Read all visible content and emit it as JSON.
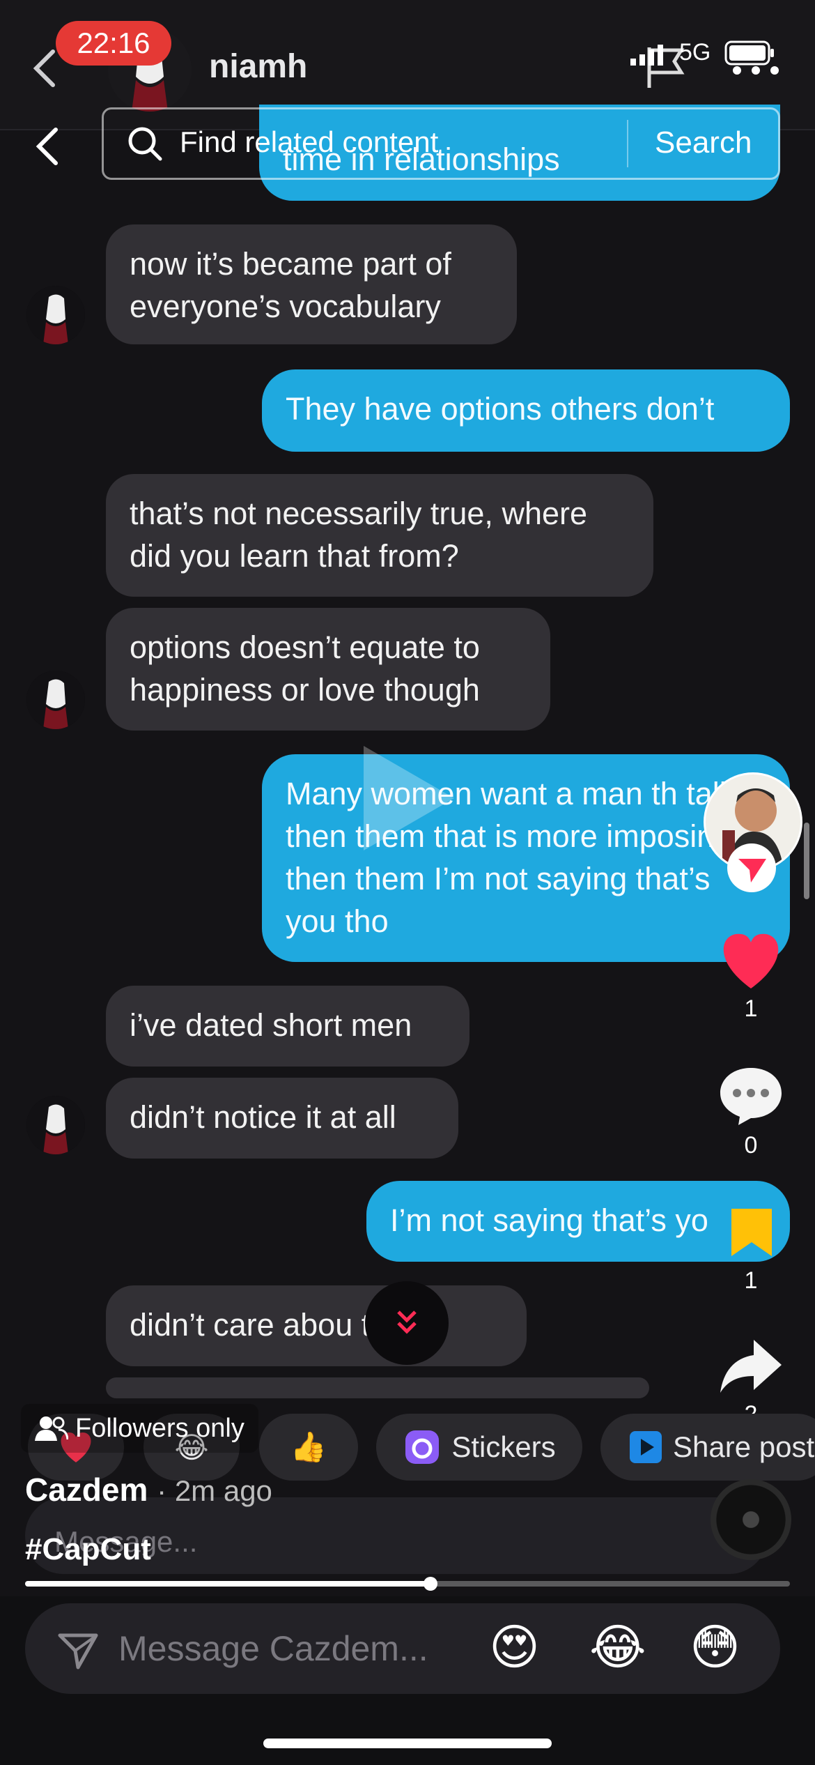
{
  "status": {
    "time": "22:16",
    "network": "5G"
  },
  "chat": {
    "contact_name": "niamh"
  },
  "search": {
    "placeholder": "Find related content",
    "button_label": "Search"
  },
  "messages": [
    {
      "side": "right",
      "text": "time in relationships"
    },
    {
      "side": "left",
      "text": "now it’s became part of everyone’s vocabulary"
    },
    {
      "side": "right",
      "text": "They have options others don’t"
    },
    {
      "side": "left",
      "text": "that’s not necessarily true, where did you learn that from?"
    },
    {
      "side": "left",
      "text": "options doesn’t equate to happiness or love though"
    },
    {
      "side": "right",
      "text": "Many women want a man th taller then them that is more imposing then them I’m not saying that’s you tho"
    },
    {
      "side": "left",
      "text": "i’ve dated short men"
    },
    {
      "side": "left",
      "text": "didn’t notice it at all"
    },
    {
      "side": "right",
      "text": "I’m not saying that’s yo"
    },
    {
      "side": "left",
      "text": "didn’t care abou   t all"
    }
  ],
  "actions": {
    "likes": "1",
    "comments": "0",
    "saves": "1",
    "shares": "2"
  },
  "video": {
    "progress_fraction": 0.53
  },
  "reactions": {
    "stickers_label": "Stickers",
    "share_post_label": "Share post"
  },
  "post": {
    "visibility": "Followers only",
    "author": "Cazdem",
    "time_ago": "· 2m ago",
    "hashtag": "#CapCut",
    "comment_placeholder": "Message..."
  },
  "composer": {
    "placeholder": "Message Cazdem...",
    "emojis": [
      "😍",
      "😂",
      "😳"
    ]
  },
  "colors": {
    "accent_blue": "#1fa9df",
    "like_red": "#fe2c55",
    "save_yellow": "#ffc107",
    "time_pill": "#e53935"
  }
}
